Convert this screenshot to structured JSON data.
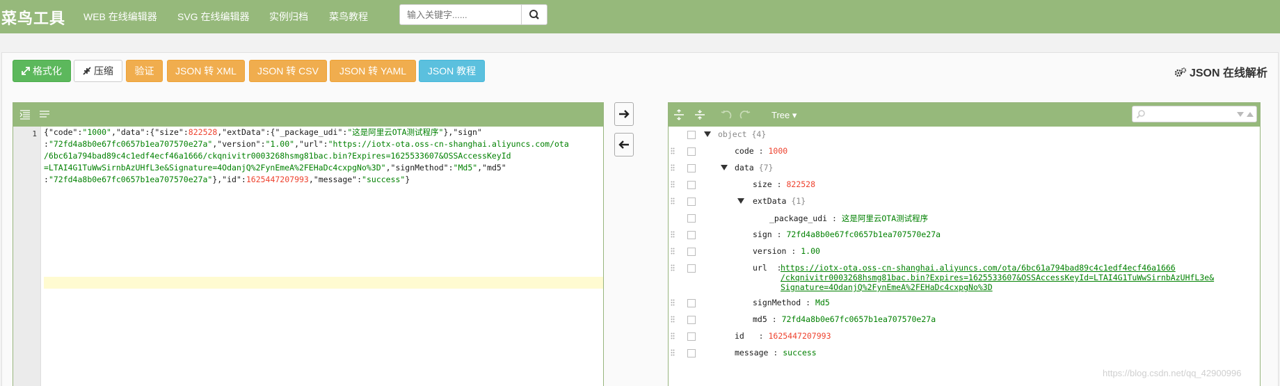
{
  "nav": {
    "brand": "菜鸟工具",
    "links": [
      "WEB 在线编辑器",
      "SVG 在线编辑器",
      "实例归档",
      "菜鸟教程"
    ],
    "search_placeholder": "输入关键字......"
  },
  "toolbar": {
    "format": "格式化",
    "compress": "压缩",
    "validate": "验证",
    "to_xml": "JSON 转 XML",
    "to_csv": "JSON 转 CSV",
    "to_yaml": "JSON 转 YAML",
    "tutorial": "JSON 教程",
    "page_title": "JSON 在线解析"
  },
  "editor": {
    "line_number": "1",
    "lines": [
      [
        [
          "p",
          "{"
        ],
        [
          "k",
          "\"code\""
        ],
        [
          "p",
          ":"
        ],
        [
          "s",
          "\"1000\""
        ],
        [
          "p",
          ","
        ],
        [
          "k",
          "\"data\""
        ],
        [
          "p",
          ":{"
        ],
        [
          "k",
          "\"size\""
        ],
        [
          "p",
          ":"
        ],
        [
          "n",
          "822528"
        ],
        [
          "p",
          ","
        ],
        [
          "k",
          "\"extData\""
        ],
        [
          "p",
          ":{"
        ],
        [
          "k",
          "\"_package_udi\""
        ],
        [
          "p",
          ":"
        ],
        [
          "s",
          "\"这是阿里云OTA测试程序\""
        ],
        [
          "p",
          "},"
        ],
        [
          "k",
          "\"sign\""
        ]
      ],
      [
        [
          "p",
          ":"
        ],
        [
          "s",
          "\"72fd4a8b0e67fc0657b1ea707570e27a\""
        ],
        [
          "p",
          ","
        ],
        [
          "k",
          "\"version\""
        ],
        [
          "p",
          ":"
        ],
        [
          "s",
          "\"1.00\""
        ],
        [
          "p",
          ","
        ],
        [
          "k",
          "\"url\""
        ],
        [
          "p",
          ":"
        ],
        [
          "s",
          "\"https://iotx-ota.oss-cn-shanghai.aliyuncs.com/ota"
        ]
      ],
      [
        [
          "s",
          "/6bc61a794bad89c4c1edf4ecf46a1666/ckqnivitr0003268hsmg81bac.bin?Expires=1625533607&OSSAccessKeyId"
        ]
      ],
      [
        [
          "s",
          "=LTAI4G1TuWwSirnbAzUHfL3e&Signature=4OdanjQ%2FynEmeA%2FEHaDc4cxpgNo%3D\""
        ],
        [
          "p",
          ","
        ],
        [
          "k",
          "\"signMethod\""
        ],
        [
          "p",
          ":"
        ],
        [
          "s",
          "\"Md5\""
        ],
        [
          "p",
          ","
        ],
        [
          "k",
          "\"md5\""
        ]
      ],
      [
        [
          "p",
          ":"
        ],
        [
          "s",
          "\"72fd4a8b0e67fc0657b1ea707570e27a\""
        ],
        [
          "p",
          "},"
        ],
        [
          "k",
          "\"id\""
        ],
        [
          "p",
          ":"
        ],
        [
          "n",
          "1625447207993"
        ],
        [
          "p",
          ","
        ],
        [
          "k",
          "\"message\""
        ],
        [
          "p",
          ":"
        ],
        [
          "s",
          "\"success\""
        ],
        [
          "p",
          "}"
        ]
      ]
    ]
  },
  "tree": {
    "mode": "Tree ▾",
    "root": {
      "label": "object",
      "count": "{4}"
    },
    "code": {
      "key": "code",
      "value": "1000"
    },
    "data": {
      "key": "data",
      "count": "{7}"
    },
    "size": {
      "key": "size",
      "value": "822528"
    },
    "extData": {
      "key": "extData",
      "count": "{1}"
    },
    "package_udi": {
      "key": "_package_udi",
      "value": "这是阿里云OTA测试程序"
    },
    "sign": {
      "key": "sign",
      "value": "72fd4a8b0e67fc0657b1ea707570e27a"
    },
    "version": {
      "key": "version",
      "value": "1.00"
    },
    "url": {
      "key": "url",
      "lines": [
        "https://iotx-ota.oss-cn-shanghai.aliyuncs.com/ota/6bc61a794bad89c4c1edf4ecf46a1666",
        "/ckqnivitr0003268hsmg81bac.bin?Expires=1625533607&OSSAccessKeyId=LTAI4G1TuWwSirnbAzUHfL3e&",
        "Signature=4OdanjQ%2FynEmeA%2FEHaDc4cxpgNo%3D"
      ]
    },
    "signMethod": {
      "key": "signMethod",
      "value": "Md5"
    },
    "md5": {
      "key": "md5",
      "value": "72fd4a8b0e67fc0657b1ea707570e27a"
    },
    "id": {
      "key": "id",
      "value": "1625447207993"
    },
    "message": {
      "key": "message",
      "value": "success"
    }
  },
  "watermark": "https://blog.csdn.net/qq_42900996",
  "colors": {
    "header": "#96b97b",
    "green_btn": "#5cb85c",
    "orange_btn": "#f0ad4e",
    "blue_btn": "#5bc0de",
    "string": "#008000",
    "number": "#ee422e"
  }
}
